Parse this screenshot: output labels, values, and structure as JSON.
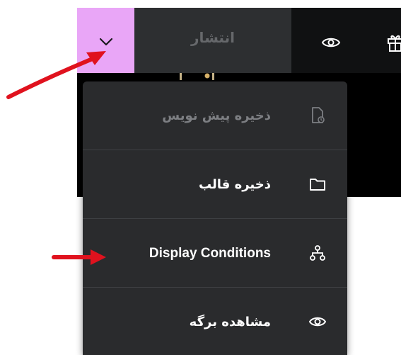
{
  "toolbar": {
    "publish_label": "انتشار",
    "icons": [
      "chevron-down-icon",
      "eye-icon",
      "gift-icon"
    ],
    "chevron_bg": "#e9a6f7",
    "bar_bg": "#101112",
    "publish_bg": "#2d2f31"
  },
  "menu": {
    "items": [
      {
        "label": "ذخیره پیش نویس",
        "icon": "file-clock-icon",
        "disabled": true
      },
      {
        "label": "ذخیره قالب",
        "icon": "folder-icon",
        "disabled": false
      },
      {
        "label": "Display Conditions",
        "icon": "sitemap-icon",
        "disabled": false
      },
      {
        "label": "مشاهده برگه",
        "icon": "eye-icon",
        "disabled": false
      }
    ],
    "bg": "#2a2b2d"
  },
  "annotation": {
    "arrow_color": "#e0121e"
  }
}
